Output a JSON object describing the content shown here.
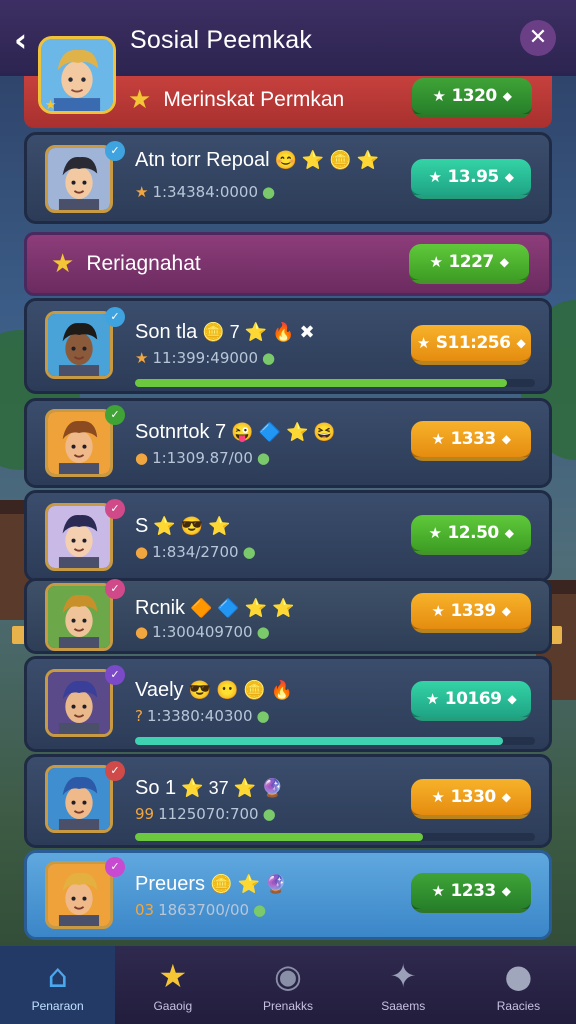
{
  "header": {
    "title": "Sosial Peemkak",
    "back_icon": "chevron-left-icon",
    "close_icon": "close-icon"
  },
  "banner_top": {
    "label": "Merinskat Permkan",
    "score": "1320"
  },
  "banner_mid": {
    "label": "Reriagnahat",
    "score": "1227"
  },
  "players": [
    {
      "name": "Atn torr Repoal",
      "emojis": "😊 ⭐ 🪙 ⭐",
      "sub_lead": "★",
      "sub": "1:34384:0000",
      "score": "13.95",
      "pill": "teal",
      "progress": null,
      "skin": "#f2c9a0",
      "hair": "#2a2a35",
      "bg": "#9fb4d6"
    },
    {
      "name": "Son tla",
      "emojis": "🪙 7 ⭐ 🔥 ✖",
      "sub_lead": "★",
      "sub": "11:399:49000",
      "score": "S11:256",
      "pill": "orange",
      "progress": 0.93,
      "bar": "#6cc83e",
      "skin": "#8a5a3a",
      "hair": "#1e1a18",
      "bg": "#4aa3d8"
    },
    {
      "name": "Sotnrtok 7",
      "emojis": "😜 🔷 ⭐ 😆",
      "sub_lead": "●",
      "sub": "1:1309.87/00",
      "score": "1333",
      "pill": "orange",
      "progress": null,
      "skin": "#f0b989",
      "hair": "#8b4a20",
      "bg": "#f0a23a"
    },
    {
      "name": "S",
      "emojis": "⭐ 😎 ⭐",
      "sub_lead": "●",
      "sub": "1:834/2700",
      "score": "12.50",
      "pill": "green",
      "progress": null,
      "skin": "#f4cfb0",
      "hair": "#2b2a55",
      "bg": "#c9b9e6"
    },
    {
      "name": "Rcnik",
      "emojis": "🔶 🔷 ⭐ ⭐",
      "sub_lead": "●",
      "sub": "1:300409700",
      "score": "1339",
      "pill": "orange",
      "progress": null,
      "skin": "#f0c49a",
      "hair": "#c8902a",
      "bg": "#6ca84a"
    },
    {
      "name": "Vaely",
      "emojis": "😎 😶 🪙 🔥",
      "sub_lead": "?",
      "sub": "1:3380:40300",
      "score": "10169",
      "pill": "teal",
      "progress": 0.92,
      "bar": "#3ed2b0",
      "skin": "#e9b98c",
      "hair": "#3a3f9a",
      "bg": "#5a4a8a"
    },
    {
      "name": "So 1",
      "emojis": "⭐ 37 ⭐ 🔮",
      "sub_lead": "99",
      "sub": "1125070:700",
      "score": "1330",
      "pill": "orange",
      "progress": 0.72,
      "bar": "#6cc83e",
      "skin": "#f0b989",
      "hair": "#2d5aa8",
      "bg": "#3f8ed0"
    },
    {
      "name": "Preuers",
      "emojis": "🪙 ⭐ 🔮",
      "sub_lead": "03",
      "sub": "1863700/00",
      "score": "1233",
      "pill": "dkgreen",
      "progress": null,
      "skin": "#f0b989",
      "hair": "#e4b040",
      "bg": "#f0a23a"
    }
  ],
  "nav": [
    {
      "label": "Penaraon",
      "icon": "home-icon",
      "glyph": "⌂"
    },
    {
      "label": "Gaaoig",
      "icon": "star-icon",
      "glyph": "★"
    },
    {
      "label": "Prenakks",
      "icon": "profile-circle-icon",
      "glyph": "◉"
    },
    {
      "label": "Saaems",
      "icon": "puzzle-icon",
      "glyph": "✦"
    },
    {
      "label": "Raacies",
      "icon": "user-icon",
      "glyph": "●"
    }
  ],
  "colors": {
    "accent_gold": "#f4c534",
    "pill_green": "#4fb52f",
    "pill_teal": "#28bc95",
    "pill_orange": "#ee9f1c",
    "header_bg": "#3d2f63"
  }
}
